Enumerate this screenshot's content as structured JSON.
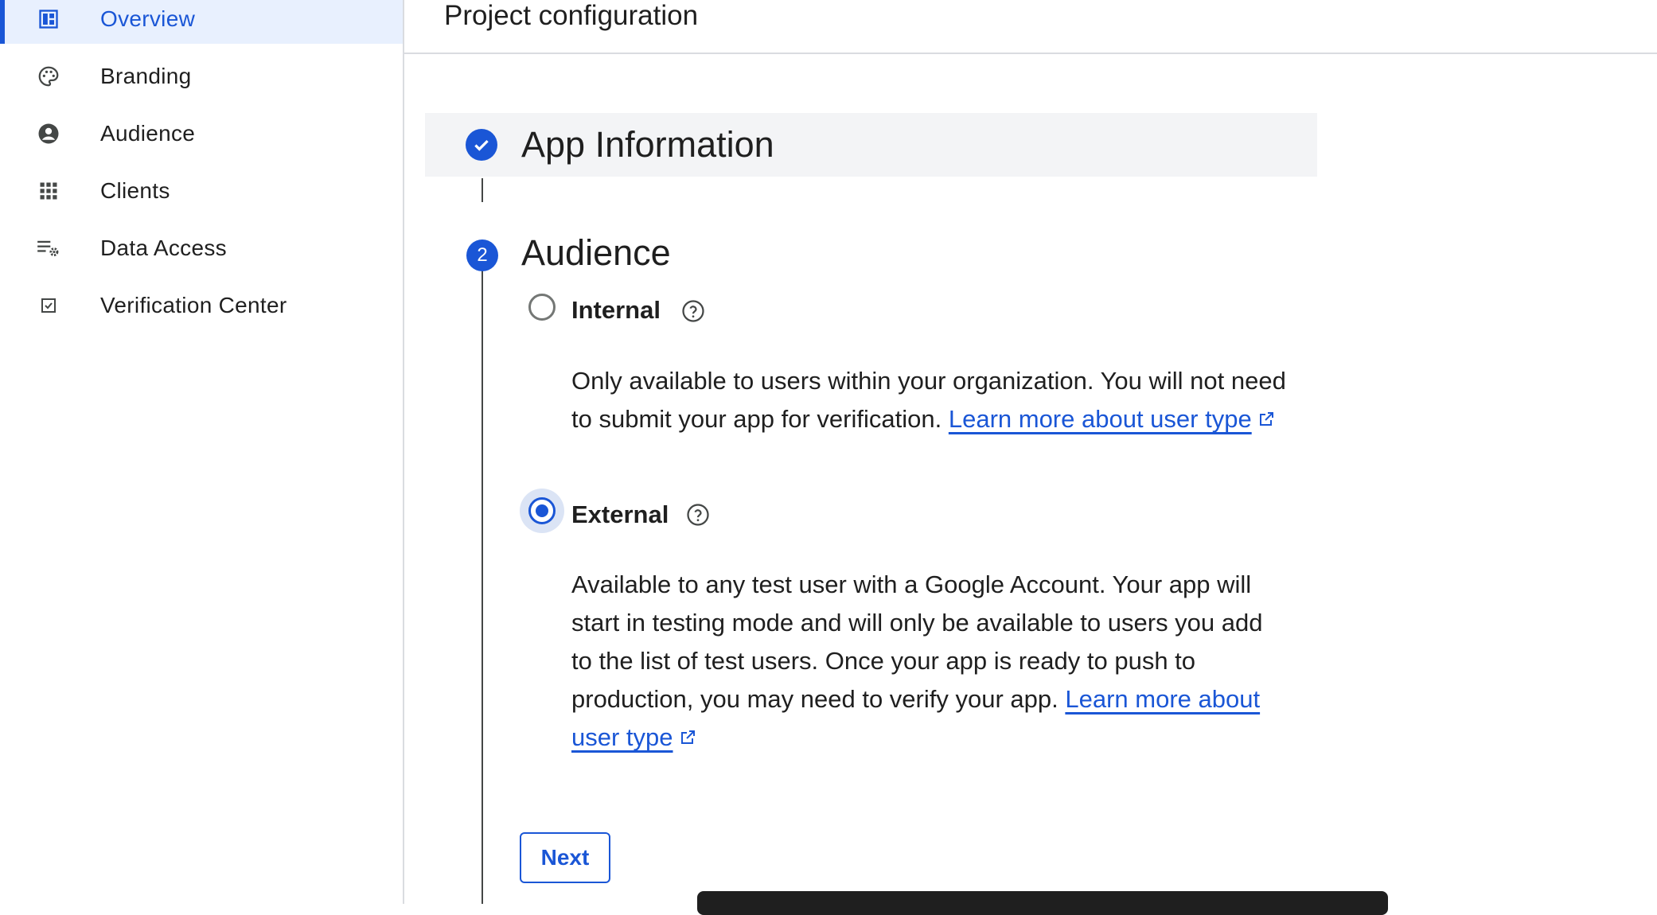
{
  "sidebar": {
    "items": [
      {
        "label": "Overview",
        "icon": "dashboard-icon",
        "active": true
      },
      {
        "label": "Branding",
        "icon": "palette-icon"
      },
      {
        "label": "Audience",
        "icon": "account-circle-icon"
      },
      {
        "label": "Clients",
        "icon": "apps-grid-icon"
      },
      {
        "label": "Data Access",
        "icon": "list-settings-icon"
      },
      {
        "label": "Verification Center",
        "icon": "checkbox-icon"
      }
    ]
  },
  "header": {
    "title": "Project configuration"
  },
  "stepper": {
    "step1": {
      "title": "App Information",
      "status": "completed"
    },
    "step2": {
      "number": "2",
      "title": "Audience",
      "options": [
        {
          "label": "Internal",
          "selected": false,
          "description": "Only available to users within your organization. You will not need to submit your app for verification.",
          "link": "Learn more about user type"
        },
        {
          "label": "External",
          "selected": true,
          "description": "Available to any test user with a Google Account. Your app will start in testing mode and will only be available to users you add to the list of test users. Once your app is ready to push to production, you may need to verify your app.",
          "link": "Learn more about user type"
        }
      ],
      "next_label": "Next"
    }
  },
  "colors": {
    "accent": "#1a56d6",
    "active_bg": "#e8f0fe",
    "step_bg": "#f3f4f6"
  }
}
